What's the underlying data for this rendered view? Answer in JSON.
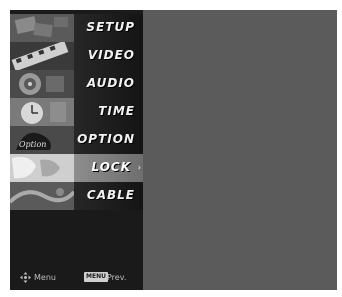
{
  "menu": {
    "items": [
      {
        "label": "SETUP",
        "selected": false
      },
      {
        "label": "VIDEO",
        "selected": false
      },
      {
        "label": "AUDIO",
        "selected": false
      },
      {
        "label": "TIME",
        "selected": false
      },
      {
        "label": "OPTION",
        "selected": false
      },
      {
        "label": "LOCK",
        "selected": true
      },
      {
        "label": "CABLE",
        "selected": false
      }
    ],
    "selected_arrow": "›"
  },
  "footer": {
    "menu_hint": "Menu",
    "key_badge": "MENU",
    "prev_hint": "Prev."
  },
  "icons": {
    "navigation": "dpad-navigation-icon",
    "selected_indicator": "chevron-right-icon"
  },
  "colors": {
    "panel": "#1a1a1a",
    "selected_row": "#9a9a9a",
    "content_area": "#5b5b5b",
    "label_text": "#f2f2f2"
  }
}
